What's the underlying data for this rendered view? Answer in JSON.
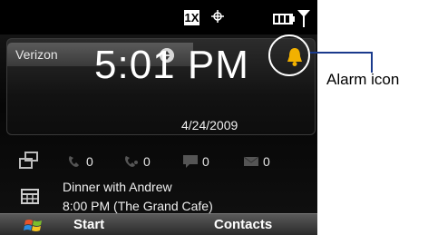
{
  "status_bar": {
    "network_label": "1X"
  },
  "home": {
    "carrier": "Verizon",
    "time": "5:01 PM",
    "date": "4/24/2009"
  },
  "notifications": [
    {
      "icon": "missed-call-icon",
      "count": "0"
    },
    {
      "icon": "voicemail-icon",
      "count": "0"
    },
    {
      "icon": "text-message-icon",
      "count": "0"
    },
    {
      "icon": "email-icon",
      "count": "0"
    }
  ],
  "appointment": {
    "title": "Dinner with Andrew",
    "detail": "8:00 PM (The Grand Cafe)"
  },
  "softkeys": {
    "left": "Start",
    "right": "Contacts"
  },
  "annotation": {
    "label": "Alarm icon"
  },
  "colors": {
    "alarm": "#f2b100",
    "callout_line": "#1a3a8c"
  }
}
